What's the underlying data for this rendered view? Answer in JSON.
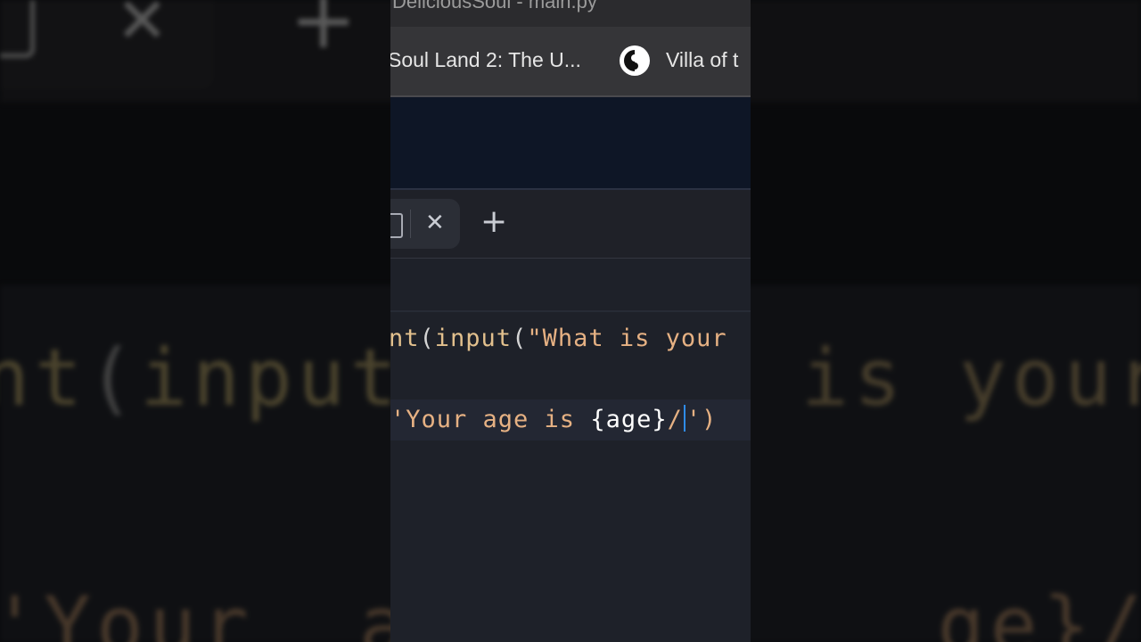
{
  "window": {
    "title": "DeliciousSoul - main.py"
  },
  "bookmarks": [
    {
      "label": "Soul Land 2: The U..."
    },
    {
      "label": "Villa of t"
    }
  ],
  "editor": {
    "lines": [
      {
        "seg": [
          "nt",
          "(",
          "input",
          "(",
          "\"What is your"
        ]
      },
      {
        "seg": [
          "'Your age is ",
          "{",
          "age",
          "}",
          "/",
          "')"
        ]
      }
    ]
  },
  "background": {
    "line1": [
      "nt",
      "(",
      "input",
      " is your"
    ],
    "line2": "'Your  ag         ge}/':)"
  },
  "colors": {
    "function": "#e2c08d",
    "string": "#e6b183",
    "cursor": "#2f8ce8",
    "header": "#0e1626"
  }
}
